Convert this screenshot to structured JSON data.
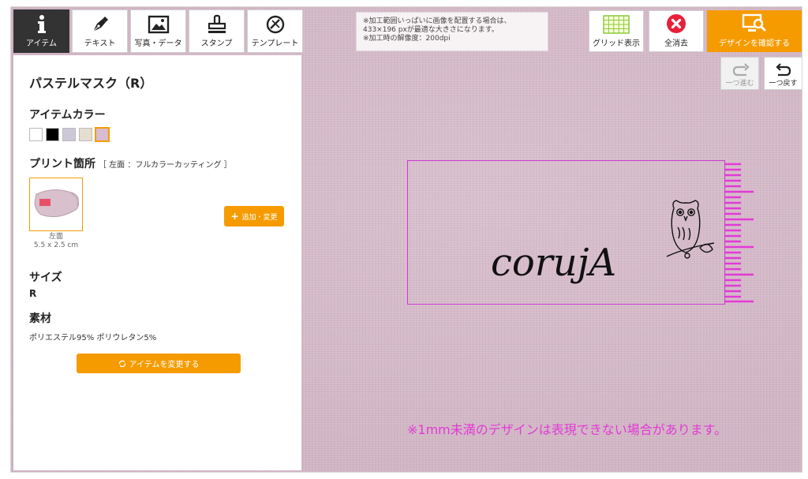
{
  "tools": [
    {
      "label": "アイテム",
      "icon": "info-icon",
      "active": true
    },
    {
      "label": "テキスト",
      "icon": "pen-icon",
      "active": false
    },
    {
      "label": "写真・データ",
      "icon": "image-icon",
      "active": false
    },
    {
      "label": "スタンプ",
      "icon": "stamp-icon",
      "active": false
    },
    {
      "label": "テンプレート",
      "icon": "template-icon",
      "active": false
    }
  ],
  "item": {
    "name": "パステルマスク（R）",
    "color_title": "アイテムカラー",
    "colors": [
      "#ffffff",
      "#000000",
      "#cdc8d8",
      "#e6dcd0",
      "#d8bcd0"
    ],
    "selected_color_index": 4,
    "print_title": "プリント箇所",
    "print_sub": "［ 左面 ：フルカラーカッティング ］",
    "print_location": "左面",
    "print_size": "5.5 x 2.5 cm",
    "add_button": "追加・変更",
    "size_title": "サイズ",
    "size_value": "R",
    "material_title": "素材",
    "material_value": "ポリエステル95% ポリウレタン5%",
    "change_button": "アイテムを変更する"
  },
  "notice": {
    "line1": "※加工範囲いっぱいに画像を配置する場合は、",
    "line2": "433×196 pxが最適な大きさになります。",
    "line3": "※加工時の解像度：200dpi"
  },
  "toolbar": {
    "grid_label": "グリッド表示",
    "clear_label": "全消去",
    "confirm_label": "デザインを確認する",
    "redo_label": "一つ進む",
    "undo_label": "一つ戻す"
  },
  "canvas": {
    "design_text": "corujA",
    "warning": "※1mm未満のデザインは表現できない場合があります。"
  },
  "colors": {
    "accent": "#f59b00",
    "canvas_bg": "#d6b8c8",
    "frame": "#cf3ad8",
    "warning": "#e23ad6",
    "clear_red": "#e8203a"
  }
}
